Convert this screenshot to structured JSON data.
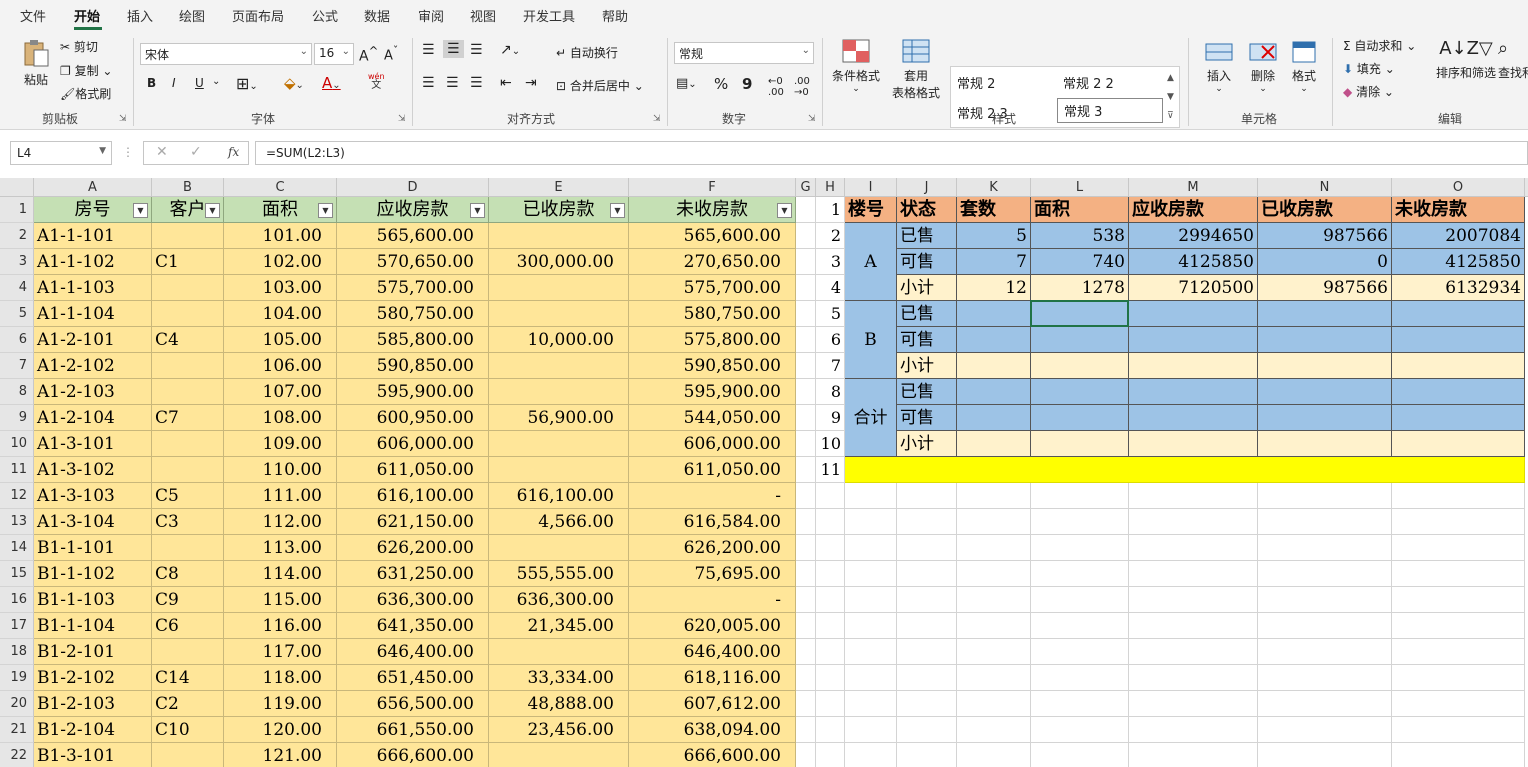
{
  "menu": [
    "文件",
    "开始",
    "插入",
    "绘图",
    "页面布局",
    "公式",
    "数据",
    "审阅",
    "视图",
    "开发工具",
    "帮助"
  ],
  "clipboard": {
    "paste": "粘贴",
    "cut": "剪切",
    "copy": "复制",
    "format_painter": "格式刷",
    "group": "剪贴板"
  },
  "font": {
    "name": "宋体",
    "size": "16",
    "bold": "B",
    "italic": "I",
    "underline": "U",
    "font_color_a": "A",
    "phonetic": "wén",
    "phonetic2": "文",
    "group": "字体"
  },
  "alignment": {
    "wrap": "自动换行",
    "merge": "合并后居中",
    "group": "对齐方式"
  },
  "number": {
    "format": "常规",
    "percent": "%",
    "comma": "9",
    "group": "数字"
  },
  "styles": {
    "cond_format": "条件格式",
    "table_format": "套用",
    "table_format2": "表格格式",
    "s1": "常规 2",
    "s2": "常规 2 2",
    "s3": "常规 2 3",
    "s4": "常规 3",
    "group": "样式"
  },
  "cells": {
    "insert": "插入",
    "delete": "删除",
    "format": "格式",
    "group": "单元格"
  },
  "editing": {
    "autosum": "自动求和",
    "fill": "填充",
    "clear": "清除",
    "sort": "排序和筛选",
    "find": "查找和",
    "group": "编辑"
  },
  "formula_bar": {
    "name_box": "L4",
    "fx": "fx",
    "formula": "=SUM(L2:L3)"
  },
  "columns_left": [
    "A",
    "B",
    "C",
    "D",
    "E",
    "F",
    "G",
    "H"
  ],
  "columns_right": [
    "I",
    "J",
    "K",
    "L",
    "M",
    "N",
    "O"
  ],
  "left_headers": [
    "房号",
    "客户",
    "面积",
    "应收房款",
    "已收房款",
    "未收房款"
  ],
  "left_rows": [
    [
      "A1-1-101",
      "",
      "101.00",
      "565,600.00",
      "",
      "565,600.00"
    ],
    [
      "A1-1-102",
      "C1",
      "102.00",
      "570,650.00",
      "300,000.00",
      "270,650.00"
    ],
    [
      "A1-1-103",
      "",
      "103.00",
      "575,700.00",
      "",
      "575,700.00"
    ],
    [
      "A1-1-104",
      "",
      "104.00",
      "580,750.00",
      "",
      "580,750.00"
    ],
    [
      "A1-2-101",
      "C4",
      "105.00",
      "585,800.00",
      "10,000.00",
      "575,800.00"
    ],
    [
      "A1-2-102",
      "",
      "106.00",
      "590,850.00",
      "",
      "590,850.00"
    ],
    [
      "A1-2-103",
      "",
      "107.00",
      "595,900.00",
      "",
      "595,900.00"
    ],
    [
      "A1-2-104",
      "C7",
      "108.00",
      "600,950.00",
      "56,900.00",
      "544,050.00"
    ],
    [
      "A1-3-101",
      "",
      "109.00",
      "606,000.00",
      "",
      "606,000.00"
    ],
    [
      "A1-3-102",
      "",
      "110.00",
      "611,050.00",
      "",
      "611,050.00"
    ],
    [
      "A1-3-103",
      "C5",
      "111.00",
      "616,100.00",
      "616,100.00",
      "-"
    ],
    [
      "A1-3-104",
      "C3",
      "112.00",
      "621,150.00",
      "4,566.00",
      "616,584.00"
    ],
    [
      "B1-1-101",
      "",
      "113.00",
      "626,200.00",
      "",
      "626,200.00"
    ],
    [
      "B1-1-102",
      "C8",
      "114.00",
      "631,250.00",
      "555,555.00",
      "75,695.00"
    ],
    [
      "B1-1-103",
      "C9",
      "115.00",
      "636,300.00",
      "636,300.00",
      "-"
    ],
    [
      "B1-1-104",
      "C6",
      "116.00",
      "641,350.00",
      "21,345.00",
      "620,005.00"
    ],
    [
      "B1-2-101",
      "",
      "117.00",
      "646,400.00",
      "",
      "646,400.00"
    ],
    [
      "B1-2-102",
      "C14",
      "118.00",
      "651,450.00",
      "33,334.00",
      "618,116.00"
    ],
    [
      "B1-2-103",
      "C2",
      "119.00",
      "656,500.00",
      "48,888.00",
      "607,612.00"
    ],
    [
      "B1-2-104",
      "C10",
      "120.00",
      "661,550.00",
      "23,456.00",
      "638,094.00"
    ],
    [
      "B1-3-101",
      "",
      "121.00",
      "666,600.00",
      "",
      "666,600.00"
    ]
  ],
  "row_numbers_left": [
    "1",
    "2",
    "3",
    "4",
    "5",
    "6",
    "7",
    "8",
    "9",
    "10",
    "11",
    "12",
    "13",
    "14",
    "15",
    "16",
    "17",
    "18",
    "19",
    "20",
    "21",
    "22"
  ],
  "row_numbers_right": [
    "1",
    "2",
    "3",
    "4",
    "5",
    "6",
    "7",
    "8",
    "9",
    "10",
    "11"
  ],
  "right_headers": [
    "楼号",
    "状态",
    "套数",
    "面积",
    "应收房款",
    "已收房款",
    "未收房款"
  ],
  "right_groups": [
    "A",
    "B",
    "合计"
  ],
  "right_status": [
    "已售",
    "可售",
    "小计",
    "已售",
    "可售",
    "小计",
    "已售",
    "可售",
    "小计"
  ],
  "right_values": [
    [
      "5",
      "538",
      "2994650",
      "987566",
      "2007084"
    ],
    [
      "7",
      "740",
      "4125850",
      "0",
      "4125850"
    ],
    [
      "12",
      "1278",
      "7120500",
      "987566",
      "6132934"
    ],
    [
      "",
      "",
      "",
      "",
      ""
    ],
    [
      "",
      "",
      "",
      "",
      ""
    ],
    [
      "",
      "",
      "",
      "",
      ""
    ],
    [
      "",
      "",
      "",
      "",
      ""
    ],
    [
      "",
      "",
      "",
      "",
      ""
    ],
    [
      "",
      "",
      "",
      "",
      ""
    ]
  ]
}
